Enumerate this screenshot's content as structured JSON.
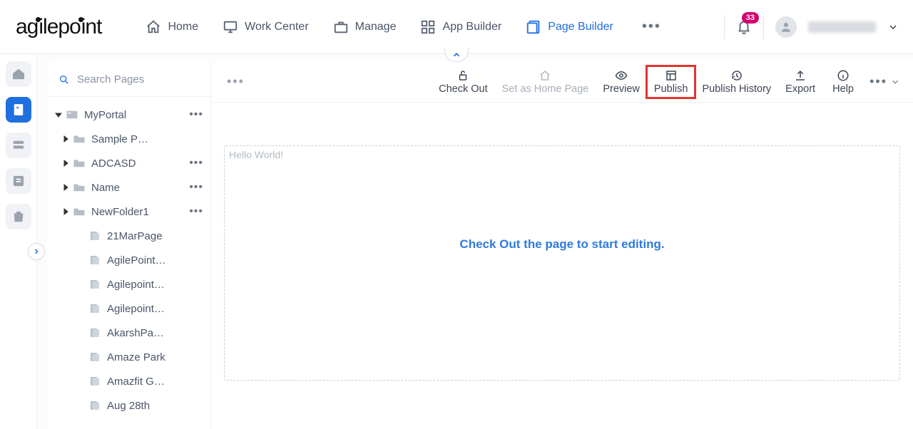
{
  "logo_text": "agilepoint",
  "topnav": {
    "home": "Home",
    "work_center": "Work Center",
    "manage": "Manage",
    "app_builder": "App Builder",
    "page_builder": "Page Builder"
  },
  "notifications_count": "33",
  "siderail": {
    "items": [
      "home",
      "page",
      "form",
      "list",
      "trash"
    ]
  },
  "search_placeholder": "Search Pages",
  "tree": {
    "root": {
      "label": "MyPortal",
      "folders": [
        {
          "label": "Sample P…",
          "more": false
        },
        {
          "label": "ADCASD",
          "more": true
        },
        {
          "label": "Name",
          "more": true
        },
        {
          "label": "NewFolder1",
          "more": true
        }
      ],
      "pages": [
        "21MarPage",
        "AgilePoint…",
        "Agilepoint…",
        "Agilepoint…",
        "AkarshPa…",
        "Amaze Park",
        "Amazfit G…",
        "Aug 28th"
      ]
    }
  },
  "toolbar": {
    "check_out": "Check Out",
    "set_home": "Set as Home Page",
    "preview": "Preview",
    "publish": "Publish",
    "publish_history": "Publish History",
    "export": "Export",
    "help": "Help"
  },
  "canvas": {
    "placeholder": "Hello World!",
    "message": "Check Out the page to start editing."
  }
}
